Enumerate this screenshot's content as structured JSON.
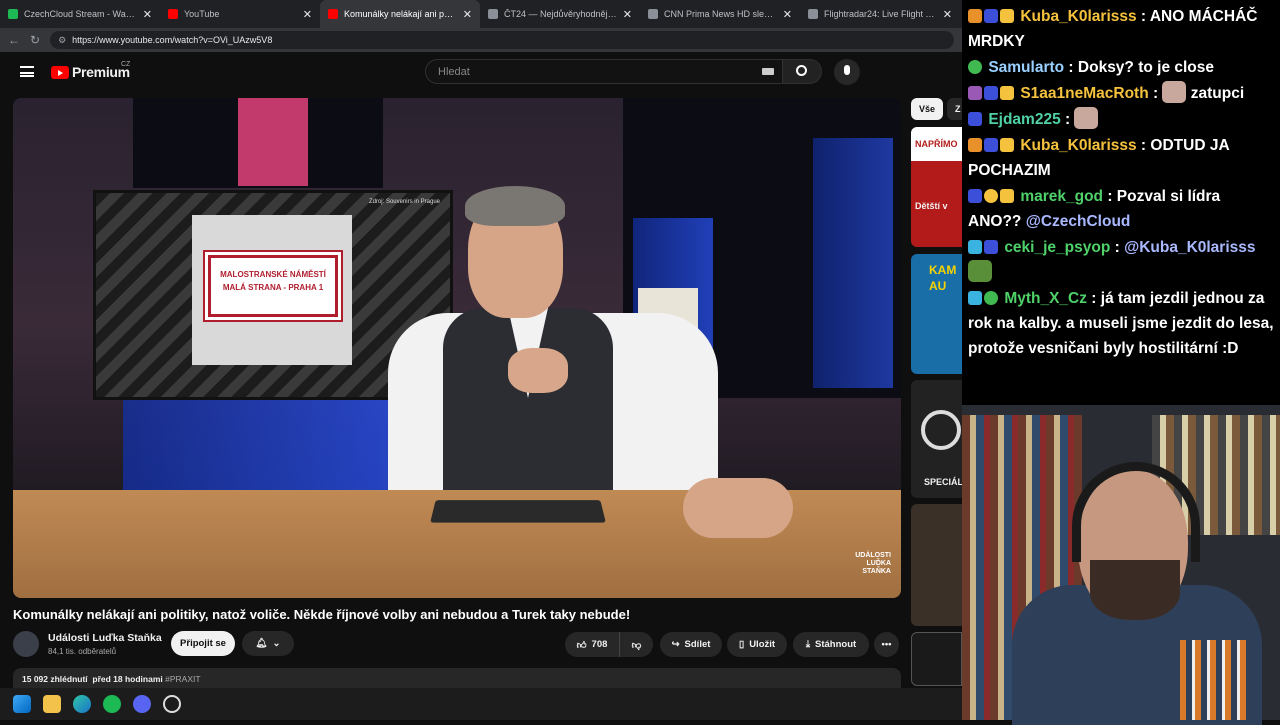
{
  "browser": {
    "tabs": [
      {
        "title": "CzechCloud Stream - Watch Live o",
        "color": "#1db954"
      },
      {
        "title": "YouTube",
        "color": "#ff0000"
      },
      {
        "title": "Komunálky nelákají ani politiky, na",
        "color": "#ff0000",
        "active": true
      },
      {
        "title": "ČT24 — Nejdůvěryhodnější zprav",
        "color": "#8a8f98"
      },
      {
        "title": "CNN Prima News HD sledujte onl",
        "color": "#8a8f98"
      },
      {
        "title": "Flightradar24: Live Flight Tracker",
        "color": "#8a8f98"
      }
    ],
    "url": "https://www.youtube.com/watch?v=OVi_UAzw5V8"
  },
  "youtube": {
    "brand": "Premium",
    "region": "CZ",
    "search_placeholder": "Hledat",
    "video": {
      "source_note": "Zdroj: Souvenirs in Prague",
      "street_sign_line1": "MALOSTRANSKÉ NÁMĚSTÍ",
      "street_sign_line2": "MALÁ STRANA - PRAHA 1",
      "watermark": "UDÁLOSTI LUĎKA STAŇKA"
    },
    "title": "Komunálky nelákají ani politiky, natož voliče. Někde říjnové volby ani nebudou a Turek taky nebude!",
    "channel": {
      "name": "Události Luďka Staňka",
      "subs": "84,1 tis. odběratelů",
      "join_label": "Připojit se"
    },
    "actions": {
      "likes": "708",
      "share": "Sdílet",
      "save": "Uložit",
      "download": "Stáhnout"
    },
    "description": {
      "meta": "15 092 zhlédnutí  před 18 hodinami",
      "tag": "#PRAXIT"
    },
    "chips": [
      "Vše",
      "Z"
    ],
    "suggestions": [
      {
        "label": "NAPŘÍMO",
        "sub": "Dětští v",
        "color": "#b31b1b"
      },
      {
        "label": "KAM AU",
        "sub": "",
        "color": "#1a6ea8"
      },
      {
        "label": "SPECIÁL",
        "sub": "",
        "color": "#222"
      },
      {
        "label": "",
        "sub": "",
        "color": "#3a3028"
      },
      {
        "label": "",
        "sub": "",
        "color": "#1a1a1a"
      }
    ]
  },
  "chat": {
    "messages": [
      {
        "user": "Kuba_K0larisss",
        "user_color": "#f5c23d",
        "badges": [
          "#e8902a",
          "#3b4fd8",
          "#f5c23d"
        ],
        "text": "ANO MÁCHÁČ MRDKY"
      },
      {
        "user": "Samularto",
        "user_color": "#9ad0ff",
        "badges": [
          "#3fb950"
        ],
        "text": "Doksy? to je close"
      },
      {
        "user": "S1aa1neMacRoth",
        "user_color": "#f5c23d",
        "badges": [
          "#9b59b6",
          "#3b4fd8",
          "#f5c23d"
        ],
        "text": "zatupci",
        "emote": true
      },
      {
        "user": "Ejdam225",
        "user_color": "#4fd1a5",
        "badges": [
          "#3b4fd8"
        ],
        "text": "",
        "emote": true
      },
      {
        "user": "Kuba_K0larisss",
        "user_color": "#f5c23d",
        "badges": [
          "#e8902a",
          "#3b4fd8",
          "#f5c23d"
        ],
        "text": "ODTUD JA POCHAZIM"
      },
      {
        "user": "marek_god",
        "user_color": "#4fd16a",
        "badges": [
          "#3b4fd8",
          "#f5c23d",
          "#f5c23d"
        ],
        "text": "Pozval si lídra ANO??",
        "mention": "@CzechCloud"
      },
      {
        "user": "ceki_je_psyop",
        "user_color": "#4fd16a",
        "badges": [
          "#3bb3e0",
          "#3b4fd8"
        ],
        "text": "",
        "mention": "@Kuba_K0larisss",
        "emote": true
      },
      {
        "user": "Myth_X_Cz",
        "user_color": "#4fd16a",
        "badges": [
          "#3bb3e0",
          "#3fb950"
        ],
        "text": "já tam jezdil jednou za rok na kalby. a museli jsme jezdit do lesa, protože vesničani byly hostilitární :D"
      }
    ]
  }
}
